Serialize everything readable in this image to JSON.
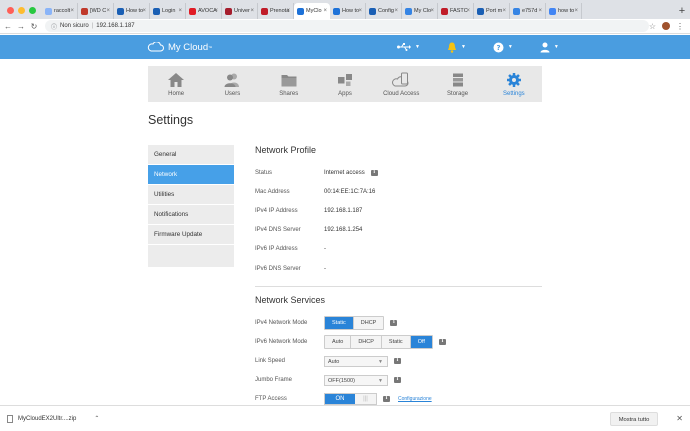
{
  "browser": {
    "tabs": [
      {
        "label": "raccolt",
        "color": "#8ab4f8",
        "active": false
      },
      {
        "label": "[WD C",
        "color": "#c0392b",
        "active": false
      },
      {
        "label": "How to",
        "color": "#1a5fb4",
        "active": false
      },
      {
        "label": "Login",
        "color": "#1a5fb4",
        "active": false
      },
      {
        "label": "AVOCA",
        "color": "#e01b24",
        "active": false
      },
      {
        "label": "Univer",
        "color": "#a51d2d",
        "active": false
      },
      {
        "label": "Prenota",
        "color": "#c01c28",
        "active": false
      },
      {
        "label": "MyClo",
        "color": "#1c71d8",
        "active": true
      },
      {
        "label": "How to",
        "color": "#1c71d8",
        "active": false
      },
      {
        "label": "Config",
        "color": "#1a5fb4",
        "active": false
      },
      {
        "label": "My Clo",
        "color": "#3584e4",
        "active": false
      },
      {
        "label": "FASTC",
        "color": "#c01c28",
        "active": false
      },
      {
        "label": "Port m",
        "color": "#1a5fb4",
        "active": false
      },
      {
        "label": "e757d",
        "color": "#3584e4",
        "active": false
      },
      {
        "label": "how to",
        "color": "#4285f4",
        "active": false
      }
    ],
    "security_label": "Non sicuro",
    "url": "192.168.1.187"
  },
  "header": {
    "app_name": "My Cloud",
    "trademark": "™"
  },
  "nav": {
    "items": [
      {
        "label": "Home",
        "icon": "home-icon"
      },
      {
        "label": "Users",
        "icon": "users-icon"
      },
      {
        "label": "Shares",
        "icon": "shares-icon"
      },
      {
        "label": "Apps",
        "icon": "apps-icon"
      },
      {
        "label": "Cloud Access",
        "icon": "cloud-access-icon"
      },
      {
        "label": "Storage",
        "icon": "storage-icon"
      },
      {
        "label": "Settings",
        "icon": "settings-icon",
        "active": true
      }
    ]
  },
  "page": {
    "title": "Settings"
  },
  "sidebar": {
    "items": [
      {
        "label": "General"
      },
      {
        "label": "Network",
        "active": true
      },
      {
        "label": "Utilities"
      },
      {
        "label": "Notifications"
      },
      {
        "label": "Firmware Update"
      }
    ]
  },
  "network_profile": {
    "title": "Network Profile",
    "rows": [
      {
        "label": "Status",
        "value": "Internet access"
      },
      {
        "label": "Mac Address",
        "value": "00:14:EE:1C:7A:16"
      },
      {
        "label": "IPv4 IP Address",
        "value": "192.168.1.187"
      },
      {
        "label": "IPv4 DNS Server",
        "value": "192.168.1.254"
      },
      {
        "label": "IPv6 IP Address",
        "value": "-"
      },
      {
        "label": "IPv6 DNS Server",
        "value": "-"
      }
    ]
  },
  "network_services": {
    "title": "Network Services",
    "ipv4_mode": {
      "label": "IPv4 Network Mode",
      "options": [
        "Static",
        "DHCP"
      ],
      "selected": "Static"
    },
    "ipv6_mode": {
      "label": "IPv6 Network Mode",
      "options": [
        "Auto",
        "DHCP",
        "Static",
        "Off"
      ],
      "selected": "Off"
    },
    "link_speed": {
      "label": "Link Speed",
      "value": "Auto"
    },
    "jumbo_frame": {
      "label": "Jumbo Frame",
      "value": "OFF(1500)"
    },
    "ftp_access": {
      "label": "FTP Access",
      "state": "ON",
      "link": "Configurazione"
    }
  },
  "download_bar": {
    "filename": "MyCloudEX2Ultr....zip",
    "show_all": "Mostra tutto"
  },
  "colors": {
    "header_blue": "#4a9de0",
    "accent_blue": "#2a84d8",
    "sidebar_active": "#46a0e8"
  }
}
